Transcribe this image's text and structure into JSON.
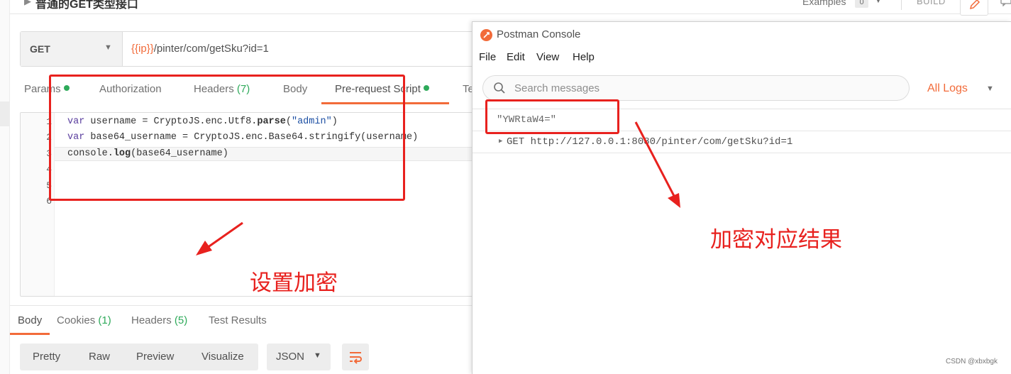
{
  "header": {
    "request_title": "普通的GET类型接口",
    "examples_label": "Examples",
    "examples_count": "0",
    "build_label": "BUILD"
  },
  "request": {
    "method": "GET",
    "url_var": "{{ip}}",
    "url_path": "/pinter/com/getSku?id=1"
  },
  "request_tabs": [
    {
      "label": "Params",
      "has_dot": true
    },
    {
      "label": "Authorization"
    },
    {
      "label": "Headers",
      "count": "(7)"
    },
    {
      "label": "Body"
    },
    {
      "label": "Pre-request Script",
      "has_dot": true,
      "active": true
    },
    {
      "label": "Te"
    }
  ],
  "editor": {
    "line_numbers": [
      "1",
      "2",
      "3",
      "4",
      "5",
      "6"
    ],
    "lines": [
      {
        "kw": "var",
        "rest": " username = CryptoJS.enc.Utf8.",
        "fn": "parse",
        "open": "(",
        "str": "\"admin\"",
        "close": ")"
      },
      {
        "kw": "var",
        "rest": " base64_username = CryptoJS.enc.Base64.stringify(username)"
      },
      {
        "pre": "console.",
        "fn": "log",
        "rest": "(base64_username)"
      }
    ]
  },
  "response_tabs": [
    {
      "label": "Body",
      "active": true
    },
    {
      "label": "Cookies",
      "count": "(1)"
    },
    {
      "label": "Headers",
      "count": "(5)"
    },
    {
      "label": "Test Results"
    }
  ],
  "response_view": {
    "modes": [
      "Pretty",
      "Raw",
      "Preview",
      "Visualize"
    ],
    "format": "JSON"
  },
  "console": {
    "title": "Postman Console",
    "menu": [
      "File",
      "Edit",
      "View",
      "Help"
    ],
    "search_placeholder": "Search messages",
    "log_filter": "All Logs",
    "logs": [
      "\"YWRtaW4=\"",
      "GET http://127.0.0.1:8080/pinter/com/getSku?id=1"
    ]
  },
  "annotations": {
    "left_note": "设置加密",
    "right_note": "加密对应结果",
    "annotation_color": "#e8211e"
  },
  "watermark": "CSDN @xbxbgk",
  "colors": {
    "accent": "#f26b3a",
    "success": "#2eaa5a"
  }
}
